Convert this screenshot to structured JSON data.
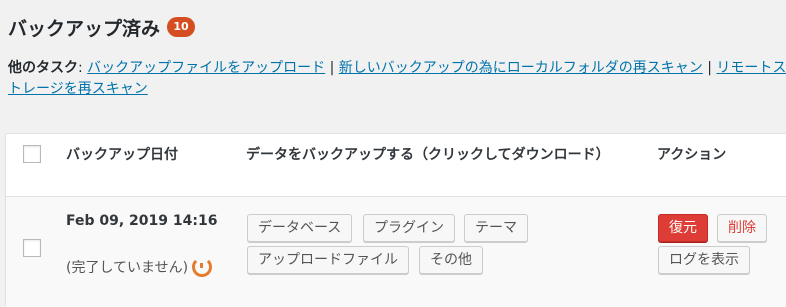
{
  "header": {
    "title": "バックアップ済み",
    "count": "10"
  },
  "other_tasks": {
    "label": "他のタスク",
    "colon": ":",
    "links": [
      "バックアップファイルをアップロード",
      "新しいバックアップの為にローカルフォルダの再スキャン",
      "リモートストレージを再スキャン"
    ],
    "separator": " | "
  },
  "table": {
    "headers": {
      "date": "バックアップ日付",
      "data": "データをバックアップする（クリックしてダウンロード）",
      "actions": "アクション"
    },
    "rows": [
      {
        "date": "Feb 09, 2019 14:16",
        "status": "(完了していません)",
        "data_buttons": [
          "データベース",
          "プラグイン",
          "テーマ",
          "アップロードファイル",
          "その他"
        ],
        "actions": {
          "restore": "復元",
          "delete": "削除",
          "view_log": "ログを表示"
        }
      }
    ]
  },
  "colors": {
    "badge": "#d54e21",
    "link": "#0073aa",
    "restore_button": "#dd3d36",
    "spinner": "#e47c2e"
  }
}
